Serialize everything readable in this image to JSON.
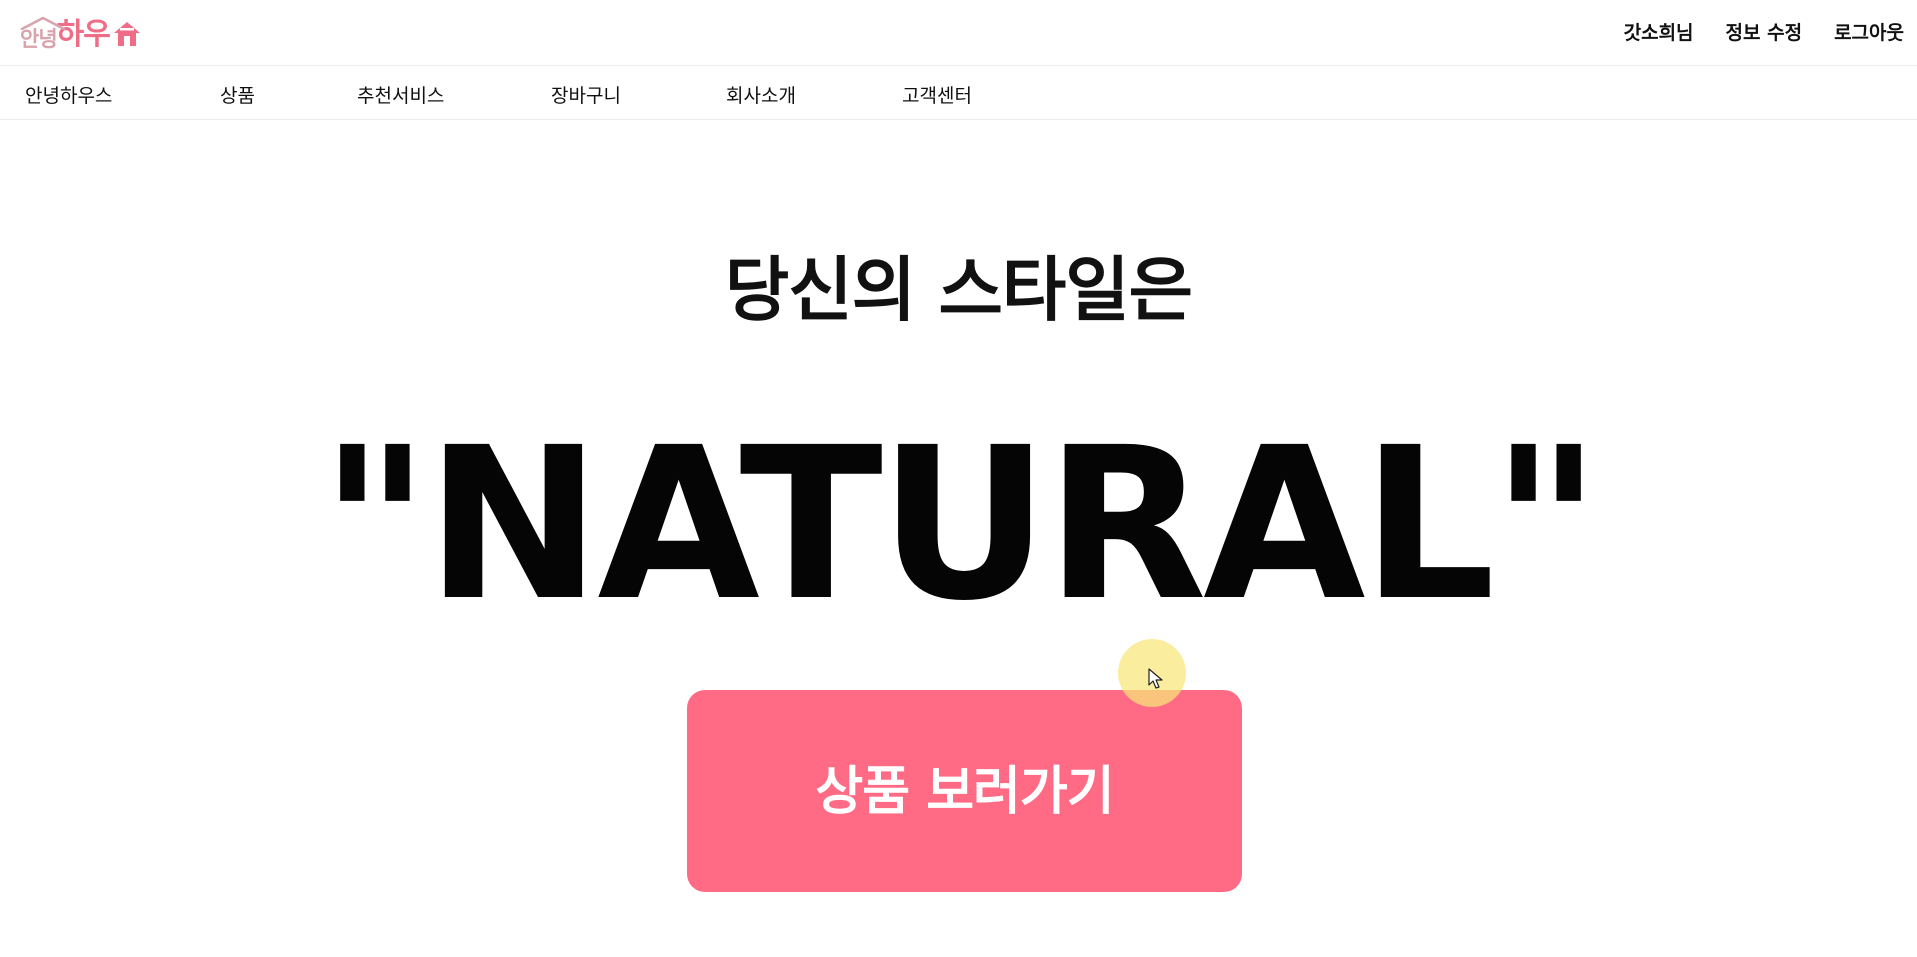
{
  "header": {
    "logo": {
      "small_text": "안녕",
      "big_text": "하우",
      "small_color": "#d9a3ad",
      "big_color": "#ef6d86",
      "icon": "house-icon"
    },
    "user": {
      "name": "갓소희님",
      "edit_profile": "정보 수정",
      "logout": "로그아웃"
    }
  },
  "nav": {
    "items": [
      {
        "label": "안녕하우스"
      },
      {
        "label": "상품"
      },
      {
        "label": "추천서비스"
      },
      {
        "label": "장바구니"
      },
      {
        "label": "회사소개"
      },
      {
        "label": "고객센터"
      }
    ]
  },
  "hero": {
    "subtitle": "당신의 스타일은",
    "style_name": "\"NATURAL\"",
    "cta_label": "상품 보러가기",
    "cta_color": "#ff6b85"
  },
  "cursor": {
    "icon": "mouse-pointer-icon",
    "highlight_color": "#f8e36f"
  }
}
